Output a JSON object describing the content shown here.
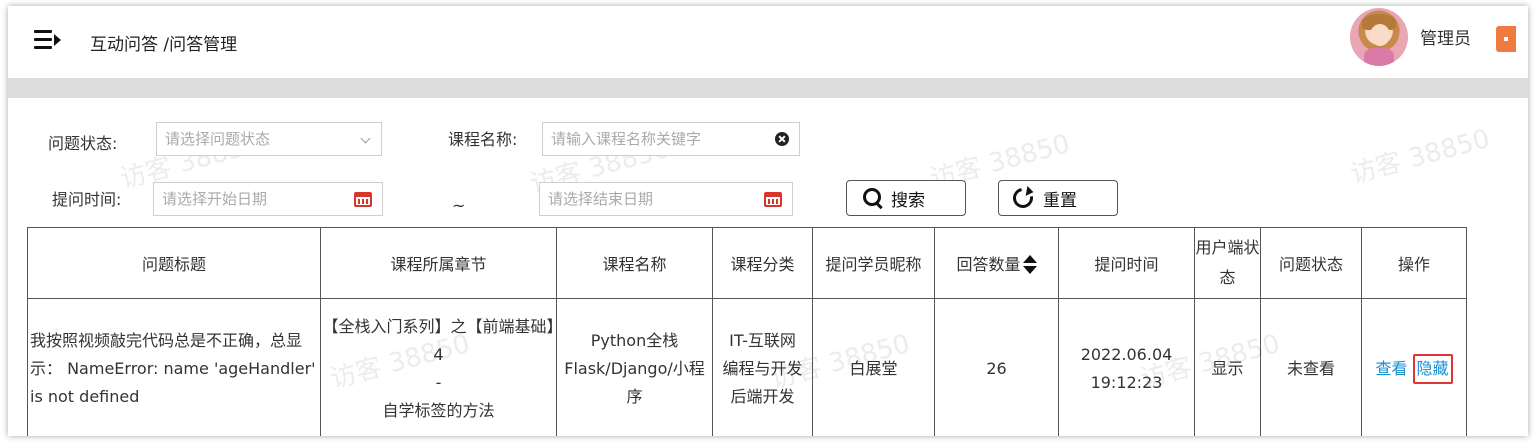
{
  "header": {
    "breadcrumb": "互动问答 /问答管理",
    "username": "管理员"
  },
  "filters": {
    "status_label": "问题状态:",
    "status_placeholder": "请选择问题状态",
    "course_label": "课程名称:",
    "course_placeholder": "请输入课程名称关键字",
    "time_label": "提问时间:",
    "start_placeholder": "请选择开始日期",
    "separator": "~",
    "end_placeholder": "请选择结束日期",
    "search_label": "搜索",
    "reset_label": "重置"
  },
  "table": {
    "headers": [
      "问题标题",
      "课程所属章节",
      "课程名称",
      "课程分类",
      "提问学员昵称",
      "回答数量",
      "提问时间",
      "用户端状态",
      "问题状态",
      "操作"
    ],
    "rows": [
      {
        "title": "我按照视频敲完代码总是不正确，总显示： NameError: name 'ageHandler' is not defined",
        "chapter": "【全栈入门系列】之【前端基础】4\n-\n自学标签的方法",
        "course": "Python全栈Flask/Django/小程序",
        "category": "IT-互联网\n编程与开发\n后端开发",
        "student": "白展堂",
        "answers": "26",
        "time": "2022.06.04\n19:12:23",
        "client_status": "显示",
        "status": "未查看",
        "actions": {
          "view": "查看",
          "hide": "隐藏"
        }
      }
    ]
  },
  "watermark": "访客 38850",
  "colors": {
    "accent_link": "#1a8fd6",
    "highlight_border": "#e23333",
    "calendar_icon": "#d9342b"
  }
}
